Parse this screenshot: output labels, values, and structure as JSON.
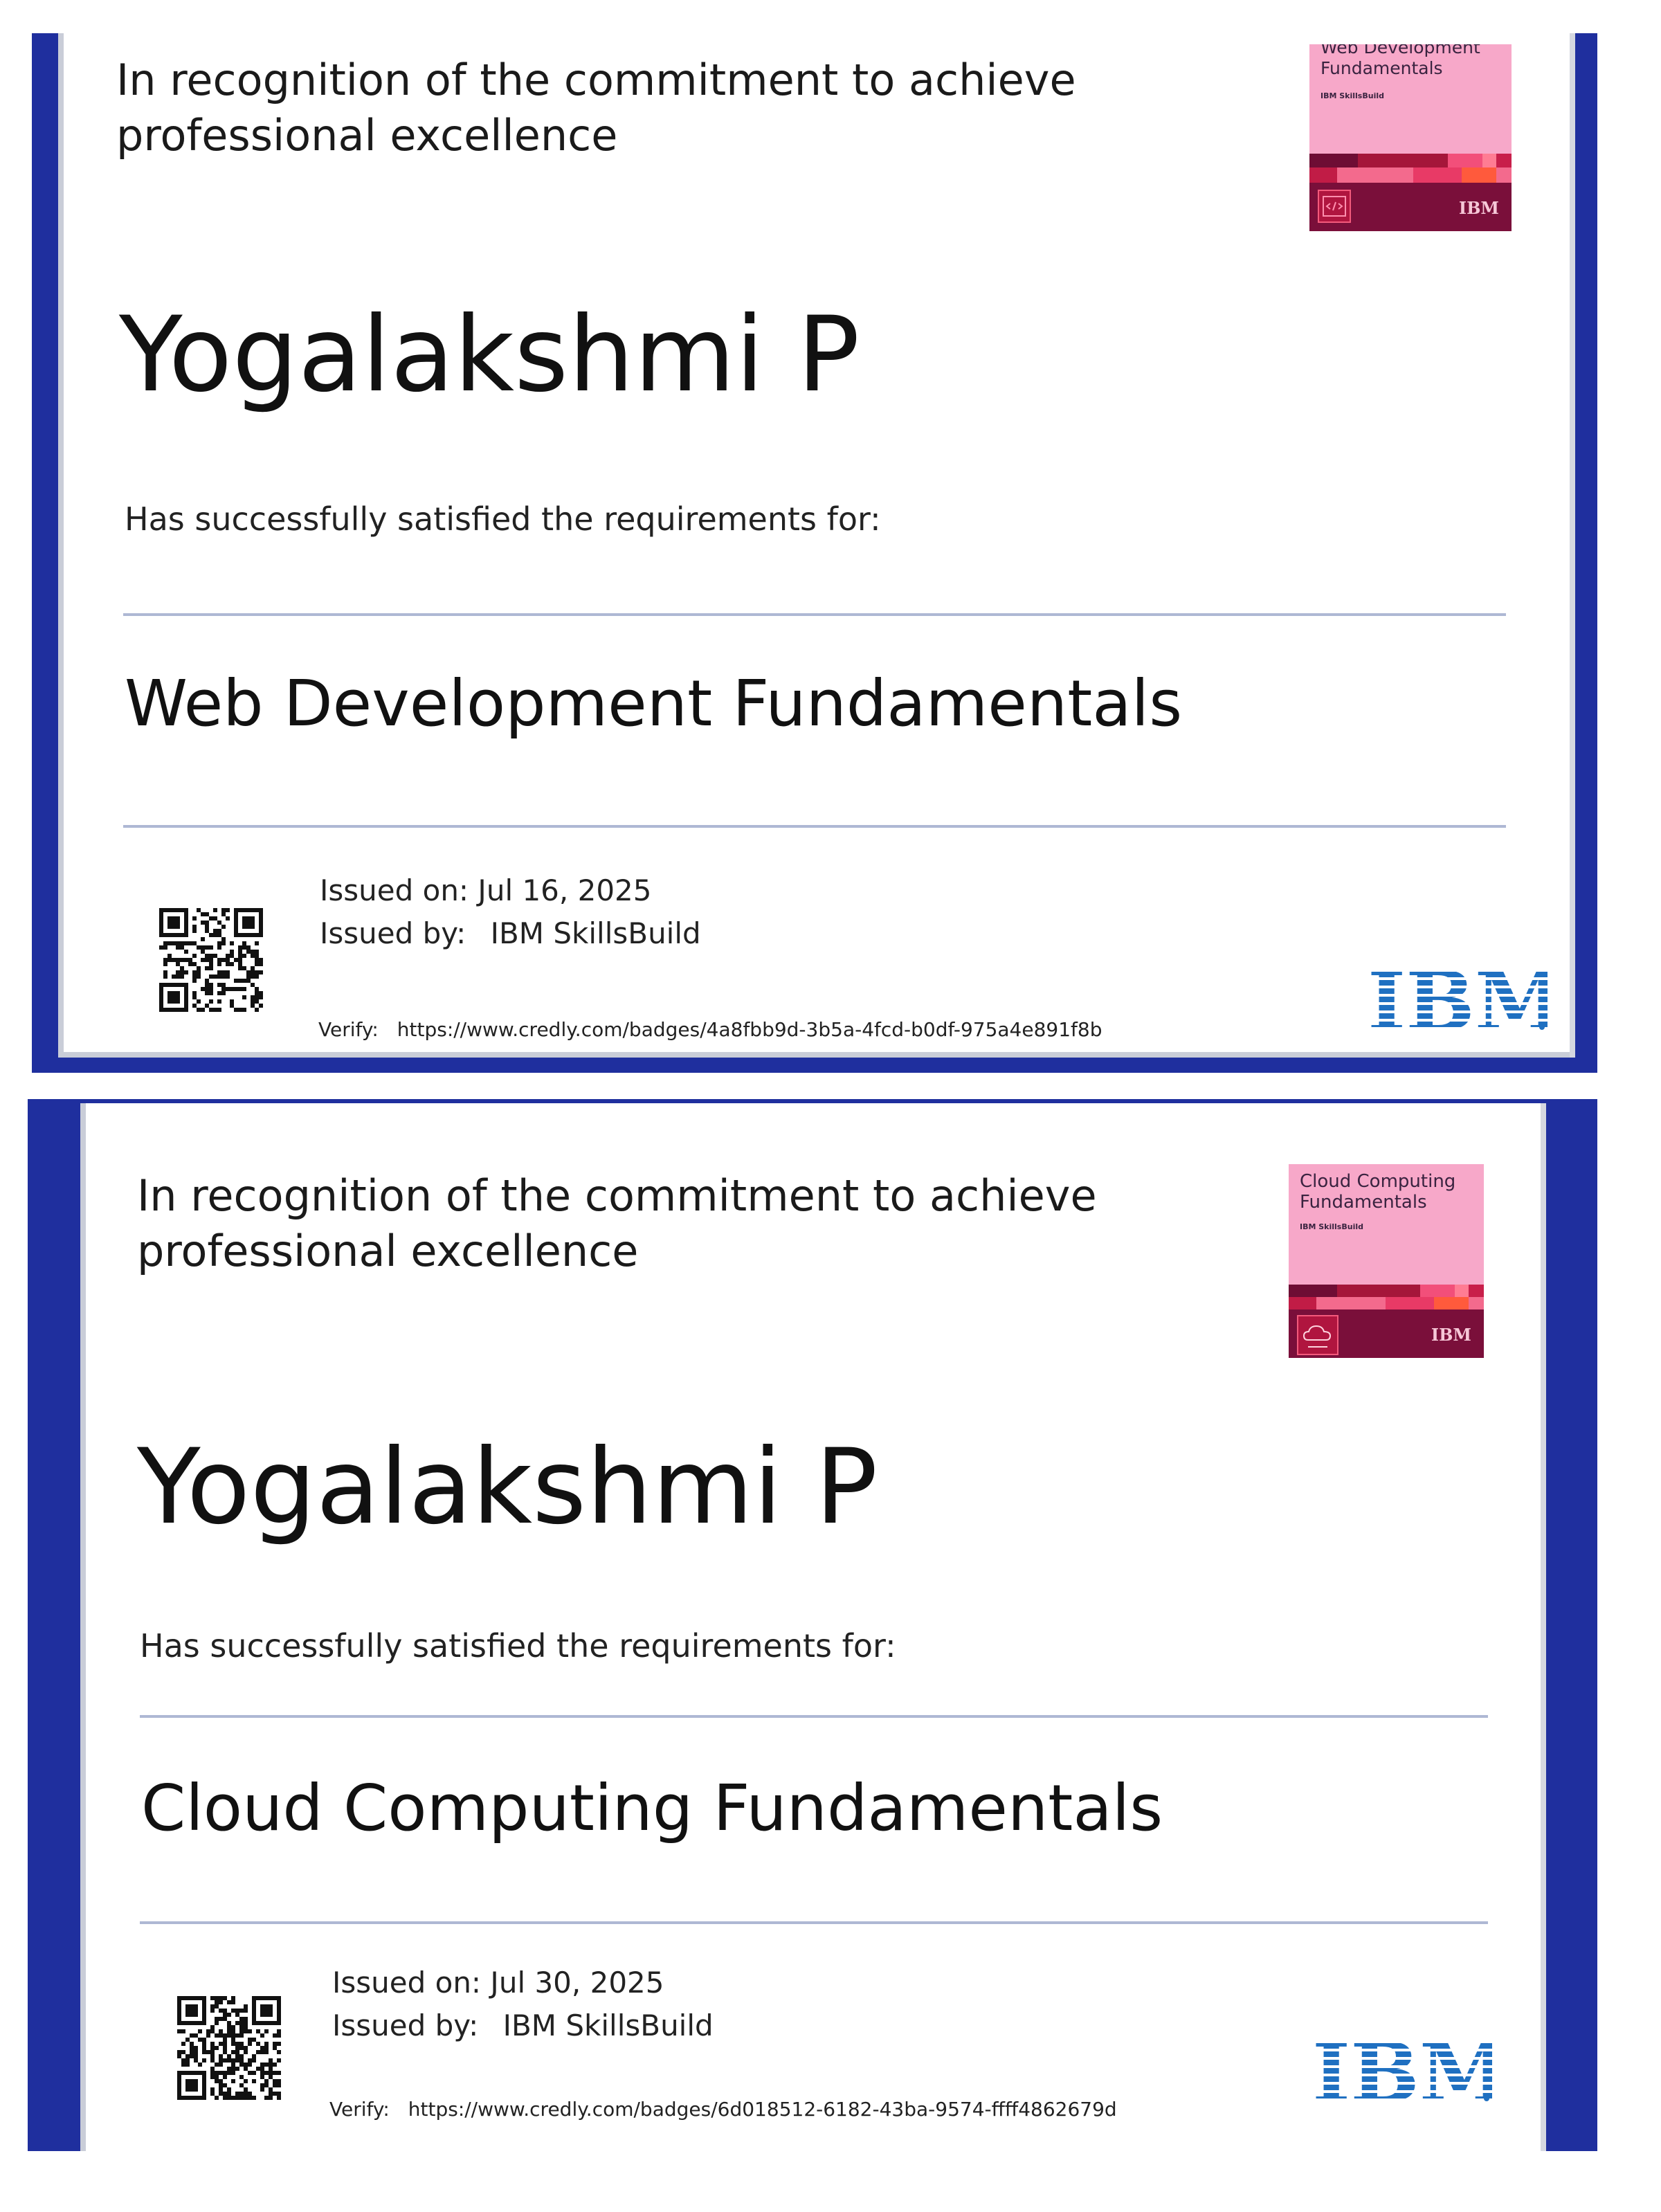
{
  "colors": {
    "frame_blue": "#1f2f9e",
    "rule": "#aeb8d4",
    "badge_pink": "#f7a8c9",
    "badge_maroon": "#7a0f3a",
    "ibm_blue": "#1f70c1"
  },
  "certificates": [
    {
      "recognition_line1": "In recognition of the commitment to achieve",
      "recognition_line2": "professional excellence",
      "recipient": "Yogalakshmi P",
      "requirement": "Has successfully satisfied the requirements for:",
      "course": "Web Development Fundamentals",
      "issued_on": "Issued on: Jul 16, 2025",
      "issued_by_label": "Issued by:",
      "issued_by": "IBM SkillsBuild",
      "verify_label": "Verify:",
      "verify_url": "https://www.credly.com/badges/4a8fbb9d-3b5a-4fcd-b0df-975a4e891f8b",
      "badge": {
        "title_line1": "Web Development",
        "title_line2": "Fundamentals",
        "brand": "IBM SkillsBuild",
        "icon": "code-icon",
        "logo_text": "IBM"
      },
      "logo": "IBM"
    },
    {
      "recognition_line1": "In recognition of the commitment to achieve",
      "recognition_line2": "professional excellence",
      "recipient": "Yogalakshmi P",
      "requirement": "Has successfully satisfied the requirements for:",
      "course": "Cloud Computing Fundamentals",
      "issued_on": "Issued on: Jul 30, 2025",
      "issued_by_label": "Issued by:",
      "issued_by": "IBM SkillsBuild",
      "verify_label": "Verify:",
      "verify_url": "https://www.credly.com/badges/6d018512-6182-43ba-9574-ffff4862679d",
      "badge": {
        "title_line1": "Cloud Computing",
        "title_line2": "Fundamentals",
        "brand": "IBM SkillsBuild",
        "icon": "cloud-icon",
        "logo_text": "IBM"
      },
      "logo": "IBM"
    }
  ]
}
